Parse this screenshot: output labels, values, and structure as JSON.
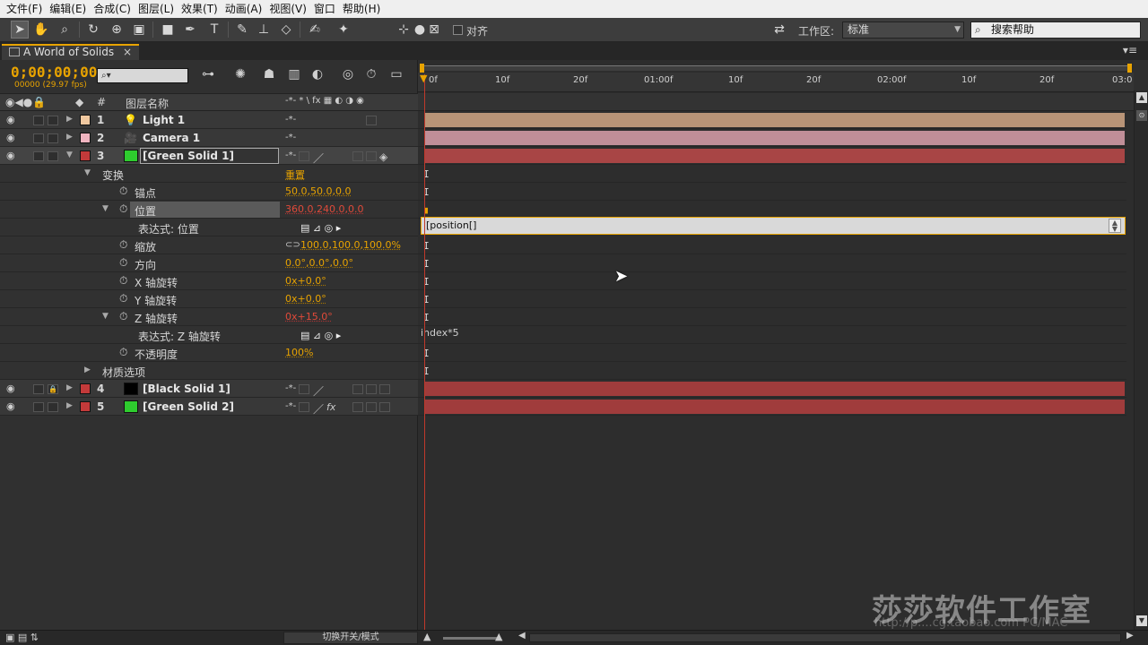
{
  "menu": [
    "文件(F)",
    "编辑(E)",
    "合成(C)",
    "图层(L)",
    "效果(T)",
    "动画(A)",
    "视图(V)",
    "窗口",
    "帮助(H)"
  ],
  "toolbar": {
    "align_label": "对齐",
    "workspace_label": "工作区:",
    "workspace_value": "标准",
    "search_placeholder": "搜索帮助"
  },
  "comp": {
    "tab_title": "A World of Solids",
    "close_glyph": "×",
    "timecode": "0;00;00;00",
    "fps": "00000 (29.97 fps)"
  },
  "columns": {
    "num": "#",
    "layer_name": "图层名称",
    "switches": "-*- * \\ fx ▦ ◐ ◑ ◉"
  },
  "layers": [
    {
      "num": "1",
      "name": "Light 1",
      "color": "#f0c8a0",
      "bar_color": "#b89477"
    },
    {
      "num": "2",
      "name": "Camera 1",
      "color": "#f0b4c0",
      "bar_color": "#c08e98"
    },
    {
      "num": "3",
      "name": "[Green Solid 1]",
      "color": "#c33a3a",
      "icon_color": "#2ecc2e",
      "bar_color": "#a84545"
    },
    {
      "num": "4",
      "name": "[Black Solid 1]",
      "color": "#c33a3a",
      "icon_color": "#000000",
      "bar_color": "#a03c3c"
    },
    {
      "num": "5",
      "name": "[Green Solid 2]",
      "color": "#c33a3a",
      "icon_color": "#2ecc2e",
      "bar_color": "#a03c3c"
    }
  ],
  "properties": {
    "transform": "变换",
    "reset": "重置",
    "anchor": "锚点",
    "anchor_value": "50.0,50.0,0.0",
    "position": "位置",
    "position_value": "360.0,240.0,0.0",
    "expr_position": "表达式: 位置",
    "scale": "缩放",
    "scale_value": "100.0,100.0,100.0%",
    "orientation": "方向",
    "orientation_value": "0.0°,0.0°,0.0°",
    "x_rotation": "X 轴旋转",
    "x_rotation_value": "0x+0.0°",
    "y_rotation": "Y 轴旋转",
    "y_rotation_value": "0x+0.0°",
    "z_rotation": "Z 轴旋转",
    "z_rotation_value": "0x+15.0°",
    "expr_z_rotation": "表达式: Z 轴旋转",
    "opacity": "不透明度",
    "opacity_value": "100%",
    "material": "材质选项"
  },
  "timeline": {
    "ruler": [
      "0f",
      "10f",
      "20f",
      "01:00f",
      "10f",
      "20f",
      "02:00f",
      "10f",
      "20f",
      "03:0"
    ],
    "expr_position_text": "[position[]",
    "expr_z_text": "index*5"
  },
  "footer": {
    "toggle_label": "切换开关/模式"
  },
  "watermark": {
    "main": "莎莎软件工作室",
    "sub": "http://p....cg.taobao.com  PC/MAC"
  }
}
